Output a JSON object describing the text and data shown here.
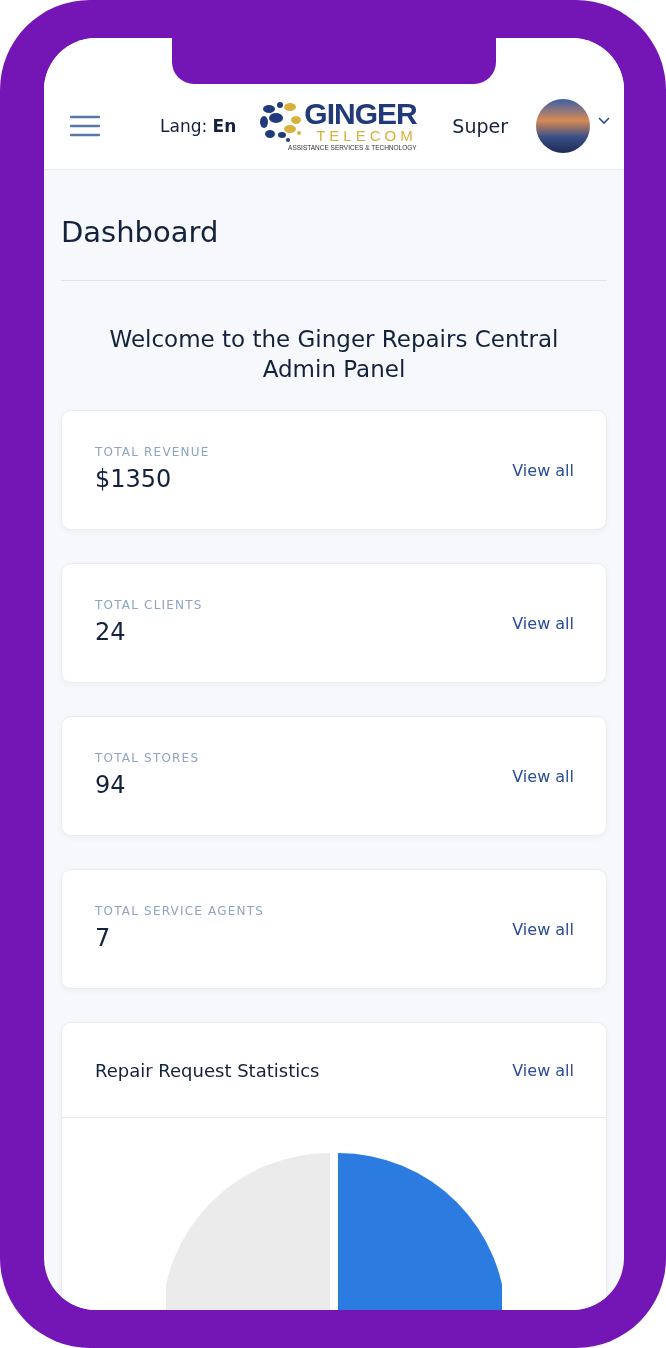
{
  "header": {
    "lang_label": "Lang:",
    "lang_value": "En",
    "logo": {
      "name": "GINGER",
      "sub": "TELECOM",
      "tagline": "ASSISTANCE SERVICES & TECHNOLOGY"
    },
    "user_name": "Super"
  },
  "page_title": "Dashboard",
  "welcome": "Welcome to the Ginger Repairs Central Admin Panel",
  "stats": [
    {
      "label": "TOTAL REVENUE",
      "value": "$1350",
      "link": "View all"
    },
    {
      "label": "TOTAL CLIENTS",
      "value": "24",
      "link": "View all"
    },
    {
      "label": "TOTAL STORES",
      "value": "94",
      "link": "View all"
    },
    {
      "label": "TOTAL SERVICE AGENTS",
      "value": "7",
      "link": "View all"
    }
  ],
  "chart_card": {
    "title": "Repair Request Statistics",
    "link": "View all"
  }
}
